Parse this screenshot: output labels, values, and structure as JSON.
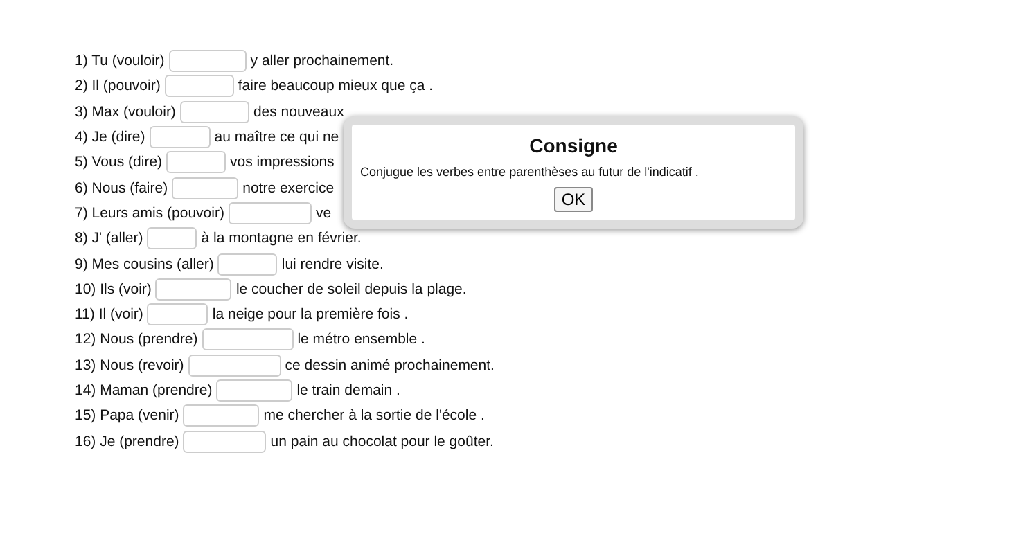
{
  "exercises": [
    {
      "number": "1)",
      "prompt": "Tu (vouloir)",
      "rest": "y aller prochainement."
    },
    {
      "number": "2)",
      "prompt": "Il (pouvoir)",
      "rest": "faire beaucoup mieux que ça ."
    },
    {
      "number": "3)",
      "prompt": "Max (vouloir)",
      "rest": "des nouveaux"
    },
    {
      "number": "4)",
      "prompt": "Je (dire)",
      "rest": "au maître ce qui ne"
    },
    {
      "number": "5)",
      "prompt": "Vous (dire)",
      "rest": "vos impressions"
    },
    {
      "number": "6)",
      "prompt": "Nous (faire)",
      "rest": "notre exercice"
    },
    {
      "number": "7)",
      "prompt": "Leurs amis (pouvoir)",
      "rest": "ve"
    },
    {
      "number": "8)",
      "prompt": "J' (aller)",
      "rest": "à la montagne en février."
    },
    {
      "number": "9)",
      "prompt": "Mes cousins (aller)",
      "rest": "lui rendre visite."
    },
    {
      "number": "10)",
      "prompt": "Ils (voir)",
      "rest": "le coucher de soleil depuis la plage."
    },
    {
      "number": "11)",
      "prompt": "Il (voir)",
      "rest": "la neige pour la première fois ."
    },
    {
      "number": "12)",
      "prompt": "Nous (prendre)",
      "rest": "le métro ensemble ."
    },
    {
      "number": "13)",
      "prompt": "Nous (revoir)",
      "rest": "ce dessin animé prochainement."
    },
    {
      "number": "14)",
      "prompt": "Maman (prendre)",
      "rest": "le train demain ."
    },
    {
      "number": "15)",
      "prompt": "Papa (venir)",
      "rest": "me chercher à la sortie de l'école ."
    },
    {
      "number": "16)",
      "prompt": "Je (prendre)",
      "rest": "un pain au chocolat pour le goûter."
    }
  ],
  "dialog": {
    "title": "Consigne",
    "message": "Conjugue les verbes entre parenthèses au futur de l'indicatif .",
    "button": "OK"
  }
}
